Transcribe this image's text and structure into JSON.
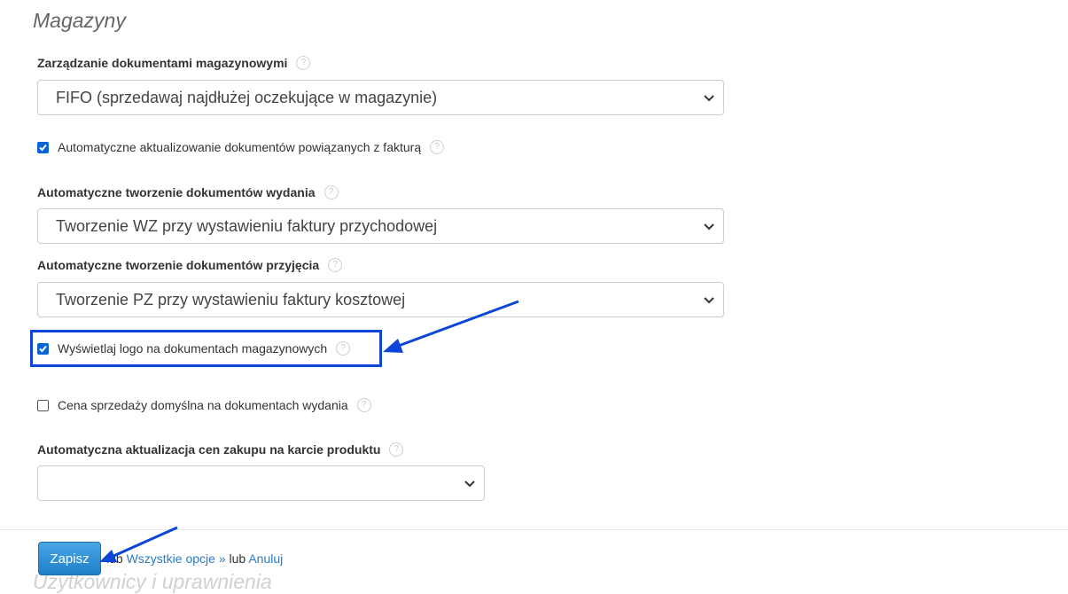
{
  "section": {
    "title": "Magazyny"
  },
  "doc_management": {
    "label": "Zarządzanie dokumentami magazynowymi",
    "selected": "FIFO (sprzedawaj najdłużej oczekujące w magazynie)"
  },
  "auto_update": {
    "label": "Automatyczne aktualizowanie dokumentów powiązanych z fakturą",
    "checked": true
  },
  "issue_docs": {
    "label": "Automatyczne tworzenie dokumentów wydania",
    "selected": "Tworzenie WZ przy wystawieniu faktury przychodowej"
  },
  "receipt_docs": {
    "label": "Automatyczne tworzenie dokumentów przyjęcia",
    "selected": "Tworzenie PZ przy wystawieniu faktury kosztowej"
  },
  "show_logo": {
    "label": "Wyświetlaj logo na dokumentach magazynowych",
    "checked": true
  },
  "default_price": {
    "label": "Cena sprzedaży domyślna na dokumentach wydania",
    "checked": false
  },
  "purchase_price_update": {
    "label": "Automatyczna aktualizacja cen zakupu na karcie produktu",
    "selected": ""
  },
  "footer": {
    "save_label": "Zapisz",
    "lub_prefix": "lub",
    "all_options_link": "Wszystkie opcje »",
    "lub_middle": "lub",
    "cancel_link": "Anuluj",
    "next_section_partial": "Użytkownicy i uprawnienia"
  },
  "help_glyph": "?",
  "colors": {
    "annotation": "#0d46d6",
    "checkbox": "#0a63d6",
    "link": "#2a7cc7",
    "button": "#2b8ad6"
  }
}
